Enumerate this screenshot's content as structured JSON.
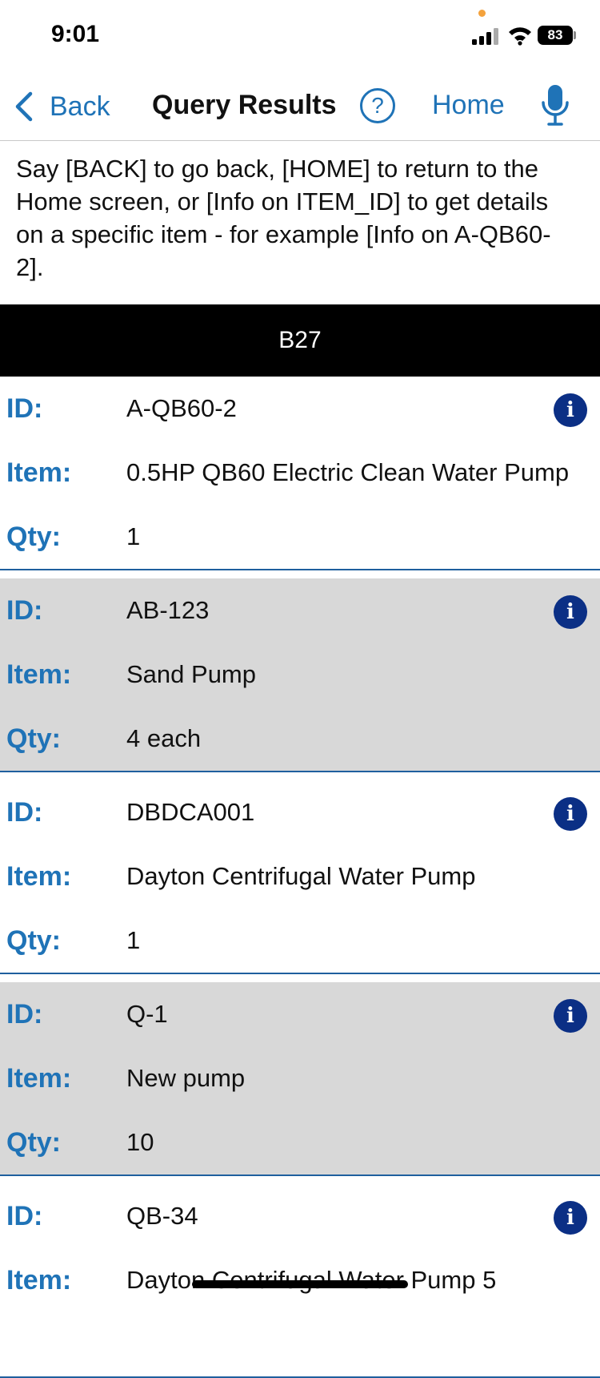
{
  "status_bar": {
    "time": "9:01",
    "battery": "83",
    "icons": [
      "signal-icon",
      "wifi-icon",
      "battery-icon"
    ]
  },
  "nav": {
    "back_label": "Back",
    "title": "Query Results",
    "help_label": "?",
    "home_label": "Home",
    "icons": [
      "chevron-left-icon",
      "help-icon",
      "microphone-icon"
    ]
  },
  "instructions": "Say [BACK] to go back, [HOME] to return to the Home screen, or [Info on ITEM_ID] to get details on a specific item - for example [Info on A-QB60-2].",
  "group": {
    "title": "B27"
  },
  "labels": {
    "id": "ID:",
    "item": "Item:",
    "qty": "Qty:"
  },
  "info_glyph": "i",
  "records": [
    {
      "id": "A-QB60-2",
      "item": "0.5HP QB60 Electric Clean Water Pump",
      "qty": "1"
    },
    {
      "id": "AB-123",
      "item": "Sand Pump",
      "qty": "4 each"
    },
    {
      "id": "DBDCA001",
      "item": "Dayton Centrifugal Water Pump",
      "qty": "1"
    },
    {
      "id": "Q-1",
      "item": "New pump",
      "qty": "10"
    },
    {
      "id": "QB-34",
      "item": "Dayton Centrifugal Water Pump 5",
      "qty": ""
    }
  ],
  "colors": {
    "accent": "#1f73b7",
    "info_button": "#0b2f85",
    "shaded_row": "#d8d8d8",
    "group_header": "#000000"
  }
}
